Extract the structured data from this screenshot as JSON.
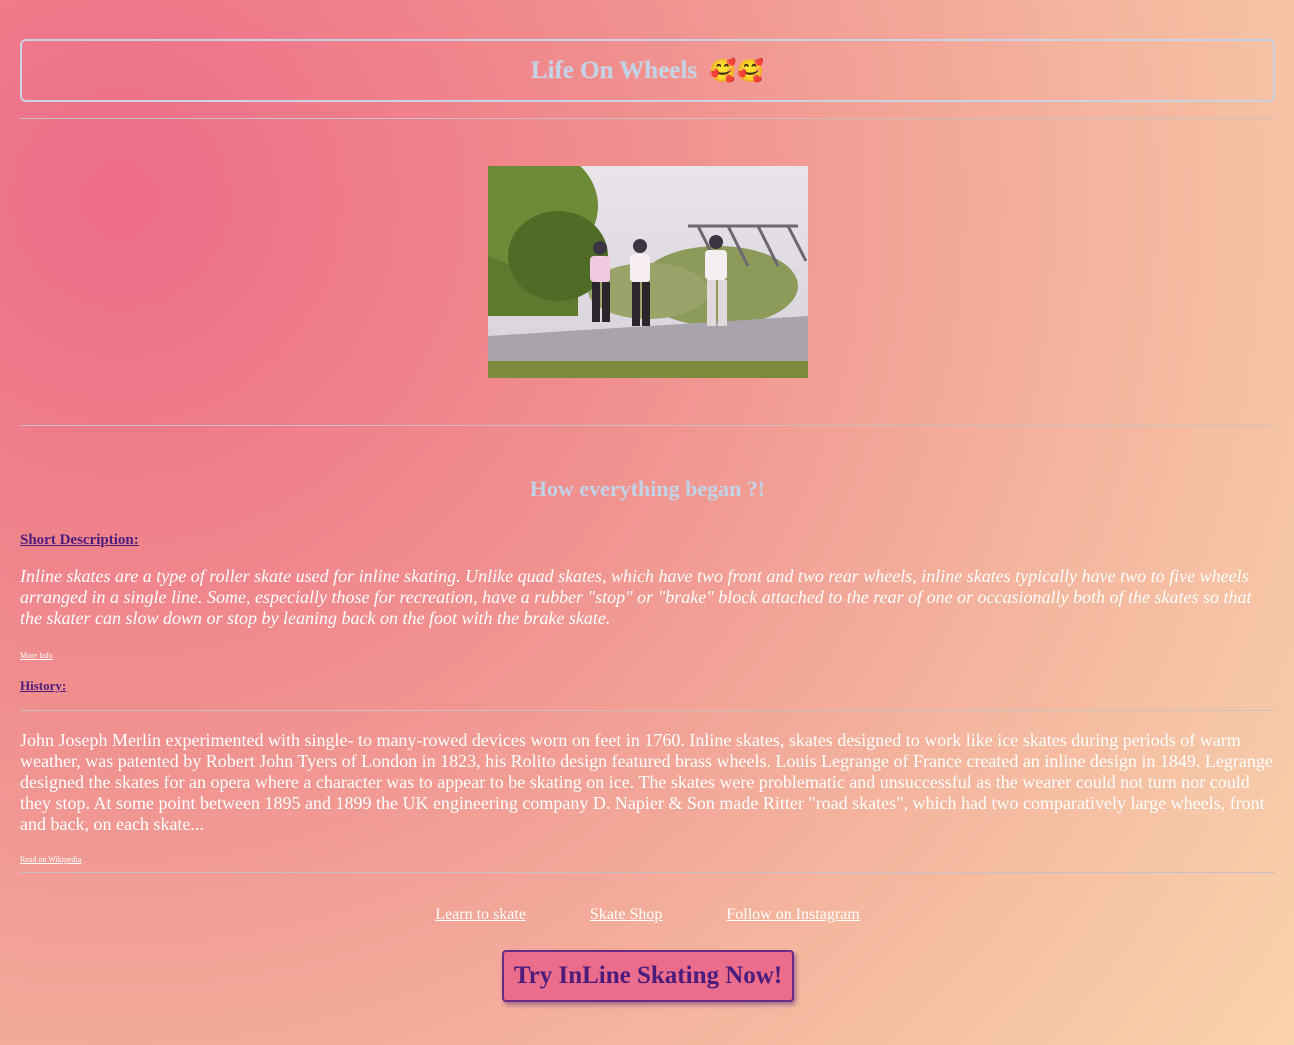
{
  "header": {
    "title": "Life On Wheels",
    "emoji": "🥰🥰"
  },
  "section": {
    "title": "How everything began ?!"
  },
  "short_description": {
    "heading": "Short Description:",
    "text": "Inline skates are a type of roller skate used for inline skating. Unlike quad skates, which have two front and two rear wheels, inline skates typically have two to five wheels arranged in a single line. Some, especially those for recreation, have a rubber \"stop\" or \"brake\" block attached to the rear of one or occasionally both of the skates so that the skater can slow down or stop by leaning back on the foot with the brake skate.",
    "link": "More Info"
  },
  "history": {
    "heading": "History:",
    "text": "John Joseph Merlin experimented with single- to many-rowed devices worn on feet in 1760. Inline skates, skates designed to work like ice skates during periods of warm weather, was patented by Robert John Tyers of London in 1823, his Rolito design featured brass wheels. Louis Legrange of France created an inline design in 1849. Legrange designed the skates for an opera where a character was to appear to be skating on ice. The skates were problematic and unsuccessful as the wearer could not turn nor could they stop. At some point between 1895 and 1899 the UK engineering company D. Napier & Son made Ritter \"road skates\", which had two comparatively large wheels, front and back, on each skate...",
    "link": "Read on Wikipedia"
  },
  "nav": [
    {
      "label": "Learn to skate "
    },
    {
      "label": "Skate Shop "
    },
    {
      "label": "Follow on Instagram"
    }
  ],
  "cta": {
    "label": "Try InLine Skating Now!"
  },
  "colors": {
    "title": "#c3d3e6",
    "link": "#4b1c7c",
    "button_bg": "#ec6d8b"
  }
}
